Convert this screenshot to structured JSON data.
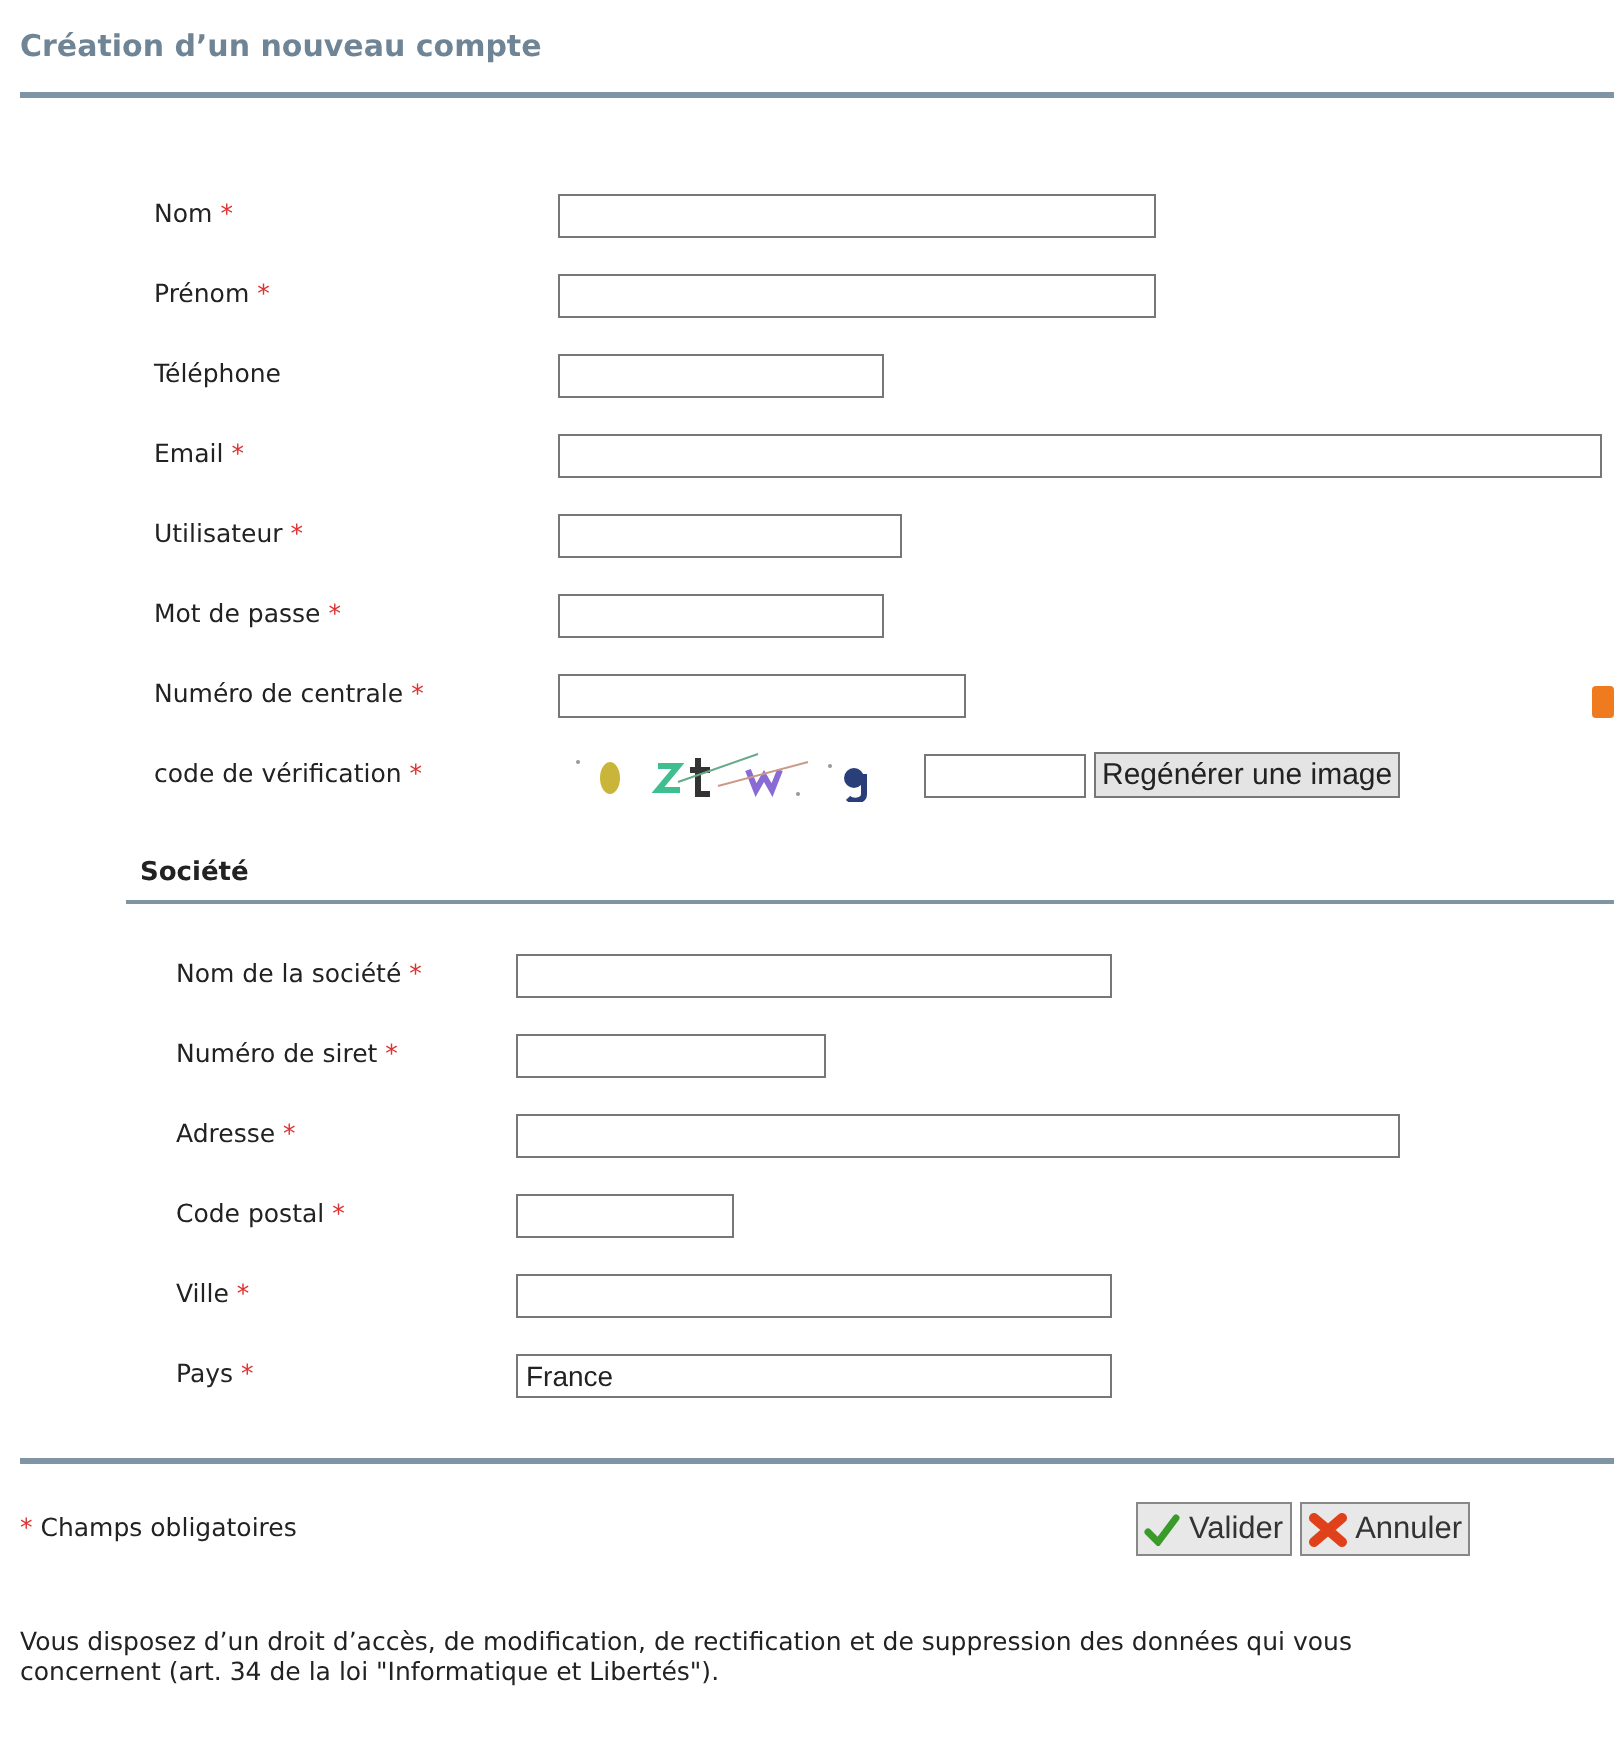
{
  "title": "Création d’un nouveau compte",
  "account_fields": [
    {
      "kind": "text",
      "label": "Nom",
      "mark": "*"
    },
    {
      "kind": "text",
      "label": "Prénom",
      "mark": "*"
    },
    {
      "kind": "text",
      "label": "Téléphone"
    },
    {
      "kind": "text",
      "label": "Email",
      "mark": "*"
    },
    {
      "kind": "text",
      "label": "Utilisateur",
      "mark": "*"
    },
    {
      "kind": "password",
      "label": "Mot de passe",
      "mark": "*"
    },
    {
      "kind": "text",
      "label": "Numéro de centrale",
      "mark": "*"
    },
    {
      "kind": "captcha",
      "label": "code de vérification",
      "mark": "*",
      "button": "Regénérer une image"
    }
  ],
  "company": {
    "heading": "Société",
    "fields": [
      {
        "label": "Nom de la société",
        "mark": "*"
      },
      {
        "label": "Numéro de siret",
        "mark": "*"
      },
      {
        "label": "Adresse",
        "mark": "*"
      },
      {
        "label": "Code postal",
        "mark": "*"
      },
      {
        "label": "Ville",
        "mark": "*"
      },
      {
        "label": "Pays",
        "mark": "*",
        "value": "France"
      }
    ]
  },
  "footer": {
    "mark": "*",
    "note": "Champs obligatoires",
    "buttons": [
      {
        "kind": "ok",
        "label": "Valider"
      },
      {
        "kind": "cancel",
        "label": "Annuler"
      }
    ]
  },
  "notice": "Vous disposez d’un droit d’accès, de modification, de rectification et de suppression des données qui vous concernent (art. 34 de la loi \"Informatique et Libertés\")."
}
